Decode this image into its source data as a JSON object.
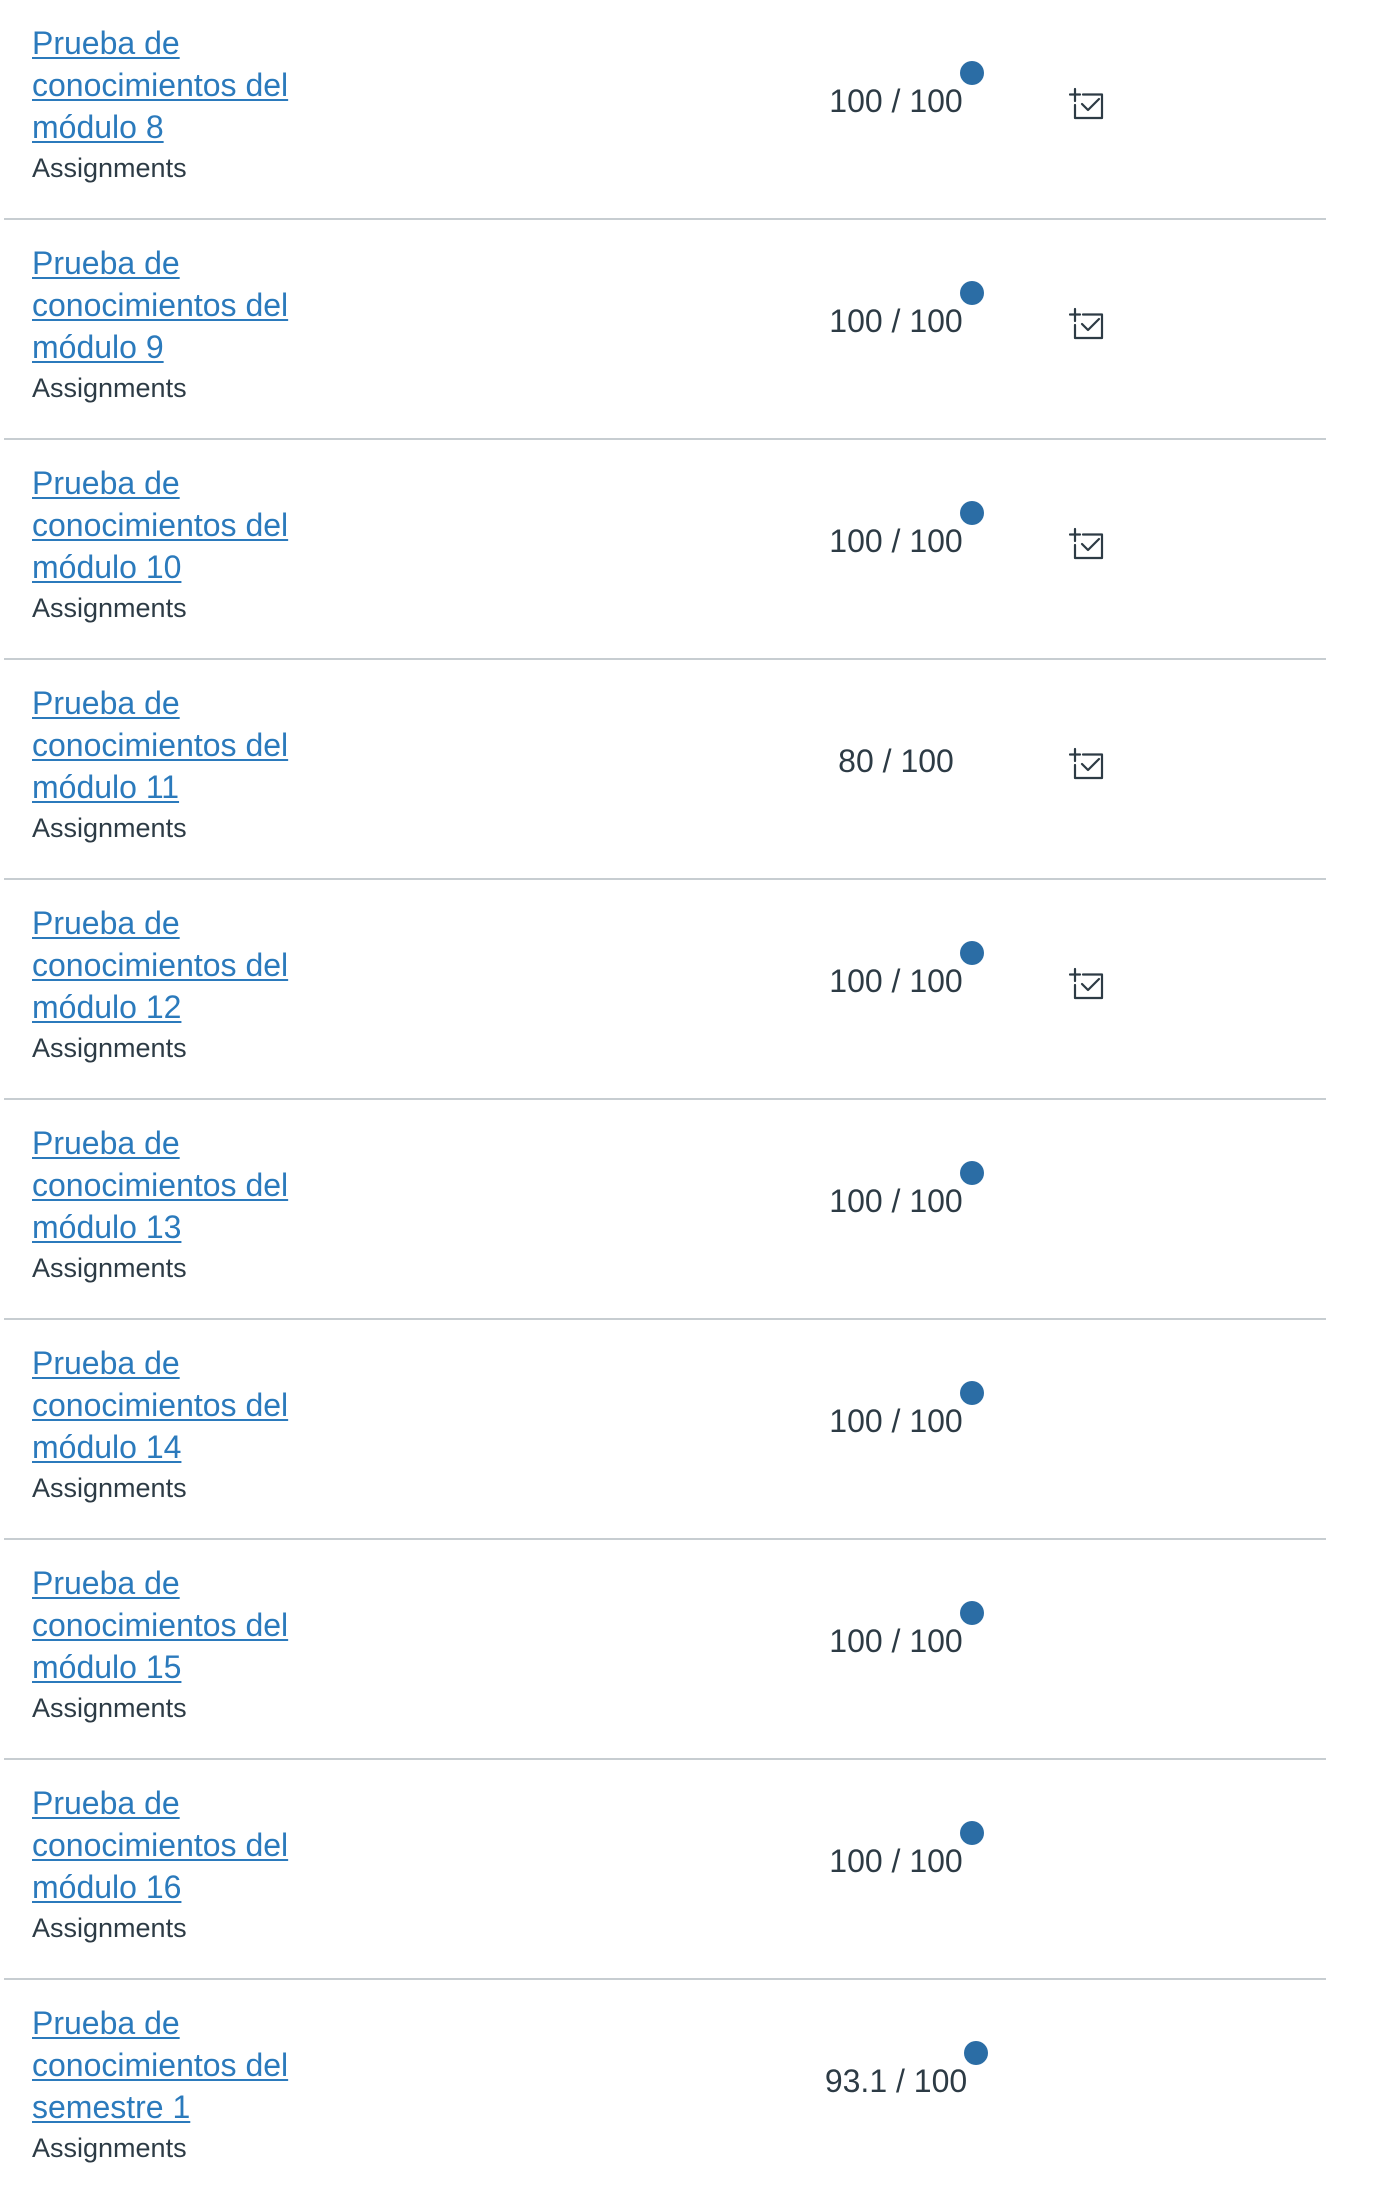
{
  "grades": {
    "rows": [
      {
        "title": "Prueba de conocimientos del módulo 8",
        "group": "Assignments",
        "score": "100 / 100",
        "unread": true,
        "rubric": true
      },
      {
        "title": "Prueba de conocimientos del módulo 9",
        "group": "Assignments",
        "score": "100 / 100",
        "unread": true,
        "rubric": true
      },
      {
        "title": "Prueba de conocimientos del módulo 10",
        "group": "Assignments",
        "score": "100 / 100",
        "unread": true,
        "rubric": true
      },
      {
        "title": "Prueba de conocimientos del módulo 11",
        "group": "Assignments",
        "score": "80 / 100",
        "unread": false,
        "rubric": true
      },
      {
        "title": "Prueba de conocimientos del módulo 12",
        "group": "Assignments",
        "score": "100 / 100",
        "unread": true,
        "rubric": true
      },
      {
        "title": "Prueba de conocimientos del módulo 13",
        "group": "Assignments",
        "score": "100 / 100",
        "unread": true,
        "rubric": false
      },
      {
        "title": "Prueba de conocimientos del módulo 14",
        "group": "Assignments",
        "score": "100 / 100",
        "unread": true,
        "rubric": false
      },
      {
        "title": "Prueba de conocimientos del módulo 15",
        "group": "Assignments",
        "score": "100 / 100",
        "unread": true,
        "rubric": false
      },
      {
        "title": "Prueba de conocimientos del módulo 16",
        "group": "Assignments",
        "score": "100 / 100",
        "unread": true,
        "rubric": false
      },
      {
        "title": "Prueba de conocimientos del semestre 1",
        "group": "Assignments",
        "score": "93.1 / 100",
        "unread": true,
        "rubric": false
      }
    ]
  },
  "icons": {
    "unread": "unread-dot-icon",
    "rubric": "rubric-icon"
  },
  "colors": {
    "link": "#2b7abc",
    "text": "#2d3b45",
    "unread_dot": "#2b6da5",
    "divider": "#c7cdd1"
  }
}
